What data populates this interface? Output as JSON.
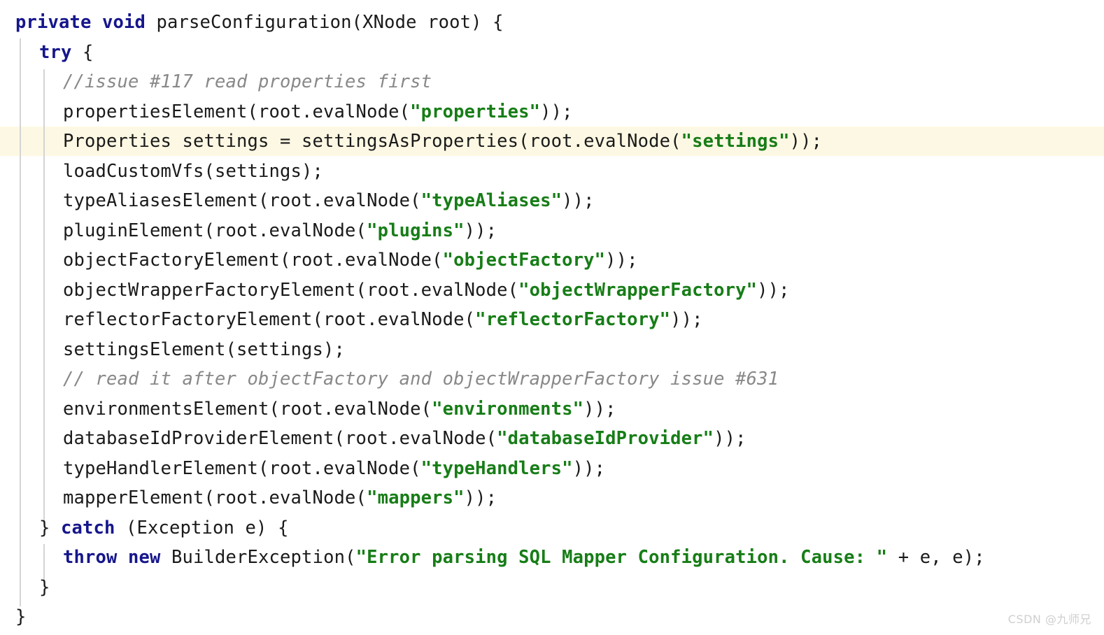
{
  "editor": {
    "language": "java",
    "method_name": "parseConfiguration",
    "highlighted_line_number": 4,
    "colors": {
      "background": "#ffffff",
      "text": "#1a1a1a",
      "keyword": "#16168c",
      "string": "#177d17",
      "comment": "#888888",
      "caret_line_background": "#fdf8e3",
      "indent_guide": "#d4d4d4",
      "watermark": "#cfcfcf"
    }
  },
  "watermark": {
    "text": "CSDN @九师兄"
  },
  "code": {
    "lines": [
      {
        "id": "line-1",
        "indent": 0,
        "highlighted": false,
        "tokens": [
          {
            "t": "kw",
            "v": "private void"
          },
          {
            "t": "plain",
            "v": " parseConfiguration(XNode root) {"
          }
        ]
      },
      {
        "id": "line-2",
        "indent": 1,
        "highlighted": false,
        "tokens": [
          {
            "t": "kw",
            "v": "try"
          },
          {
            "t": "plain",
            "v": " {"
          }
        ]
      },
      {
        "id": "line-3",
        "indent": 2,
        "highlighted": false,
        "tokens": [
          {
            "t": "cmt",
            "v": "//issue #117 read properties first"
          }
        ]
      },
      {
        "id": "line-4",
        "indent": 2,
        "highlighted": false,
        "tokens": [
          {
            "t": "plain",
            "v": "propertiesElement(root.evalNode("
          },
          {
            "t": "str",
            "v": "\"properties\""
          },
          {
            "t": "plain",
            "v": "));"
          }
        ]
      },
      {
        "id": "line-5",
        "indent": 2,
        "highlighted": true,
        "tokens": [
          {
            "t": "plain",
            "v": "Properties settings = settingsAsProperties(root.evalNode("
          },
          {
            "t": "str",
            "v": "\"settings\""
          },
          {
            "t": "plain",
            "v": "));"
          }
        ]
      },
      {
        "id": "line-6",
        "indent": 2,
        "highlighted": false,
        "tokens": [
          {
            "t": "plain",
            "v": "loadCustomVfs(settings);"
          }
        ]
      },
      {
        "id": "line-7",
        "indent": 2,
        "highlighted": false,
        "tokens": [
          {
            "t": "plain",
            "v": "typeAliasesElement(root.evalNode("
          },
          {
            "t": "str",
            "v": "\"typeAliases\""
          },
          {
            "t": "plain",
            "v": "));"
          }
        ]
      },
      {
        "id": "line-8",
        "indent": 2,
        "highlighted": false,
        "tokens": [
          {
            "t": "plain",
            "v": "pluginElement(root.evalNode("
          },
          {
            "t": "str",
            "v": "\"plugins\""
          },
          {
            "t": "plain",
            "v": "));"
          }
        ]
      },
      {
        "id": "line-9",
        "indent": 2,
        "highlighted": false,
        "tokens": [
          {
            "t": "plain",
            "v": "objectFactoryElement(root.evalNode("
          },
          {
            "t": "str",
            "v": "\"objectFactory\""
          },
          {
            "t": "plain",
            "v": "));"
          }
        ]
      },
      {
        "id": "line-10",
        "indent": 2,
        "highlighted": false,
        "tokens": [
          {
            "t": "plain",
            "v": "objectWrapperFactoryElement(root.evalNode("
          },
          {
            "t": "str",
            "v": "\"objectWrapperFactory\""
          },
          {
            "t": "plain",
            "v": "));"
          }
        ]
      },
      {
        "id": "line-11",
        "indent": 2,
        "highlighted": false,
        "tokens": [
          {
            "t": "plain",
            "v": "reflectorFactoryElement(root.evalNode("
          },
          {
            "t": "str",
            "v": "\"reflectorFactory\""
          },
          {
            "t": "plain",
            "v": "));"
          }
        ]
      },
      {
        "id": "line-12",
        "indent": 2,
        "highlighted": false,
        "tokens": [
          {
            "t": "plain",
            "v": "settingsElement(settings);"
          }
        ]
      },
      {
        "id": "line-13",
        "indent": 2,
        "highlighted": false,
        "tokens": [
          {
            "t": "cmt",
            "v": "// read it after objectFactory and objectWrapperFactory issue #631"
          }
        ]
      },
      {
        "id": "line-14",
        "indent": 2,
        "highlighted": false,
        "tokens": [
          {
            "t": "plain",
            "v": "environmentsElement(root.evalNode("
          },
          {
            "t": "str",
            "v": "\"environments\""
          },
          {
            "t": "plain",
            "v": "));"
          }
        ]
      },
      {
        "id": "line-15",
        "indent": 2,
        "highlighted": false,
        "tokens": [
          {
            "t": "plain",
            "v": "databaseIdProviderElement(root.evalNode("
          },
          {
            "t": "str",
            "v": "\"databaseIdProvider\""
          },
          {
            "t": "plain",
            "v": "));"
          }
        ]
      },
      {
        "id": "line-16",
        "indent": 2,
        "highlighted": false,
        "tokens": [
          {
            "t": "plain",
            "v": "typeHandlerElement(root.evalNode("
          },
          {
            "t": "str",
            "v": "\"typeHandlers\""
          },
          {
            "t": "plain",
            "v": "));"
          }
        ]
      },
      {
        "id": "line-17",
        "indent": 2,
        "highlighted": false,
        "tokens": [
          {
            "t": "plain",
            "v": "mapperElement(root.evalNode("
          },
          {
            "t": "str",
            "v": "\"mappers\""
          },
          {
            "t": "plain",
            "v": "));"
          }
        ]
      },
      {
        "id": "line-18",
        "indent": 1,
        "highlighted": false,
        "tokens": [
          {
            "t": "plain",
            "v": "} "
          },
          {
            "t": "kw",
            "v": "catch"
          },
          {
            "t": "plain",
            "v": " (Exception e) {"
          }
        ]
      },
      {
        "id": "line-19",
        "indent": 2,
        "highlighted": false,
        "tokens": [
          {
            "t": "kw",
            "v": "throw new"
          },
          {
            "t": "plain",
            "v": " BuilderException("
          },
          {
            "t": "str",
            "v": "\"Error parsing SQL Mapper Configuration. Cause: \""
          },
          {
            "t": "plain",
            "v": " + e, e);"
          }
        ]
      },
      {
        "id": "line-20",
        "indent": 1,
        "highlighted": false,
        "tokens": [
          {
            "t": "plain",
            "v": "}"
          }
        ]
      },
      {
        "id": "line-21",
        "indent": 0,
        "highlighted": false,
        "tokens": [
          {
            "t": "plain",
            "v": "}"
          }
        ]
      }
    ]
  }
}
